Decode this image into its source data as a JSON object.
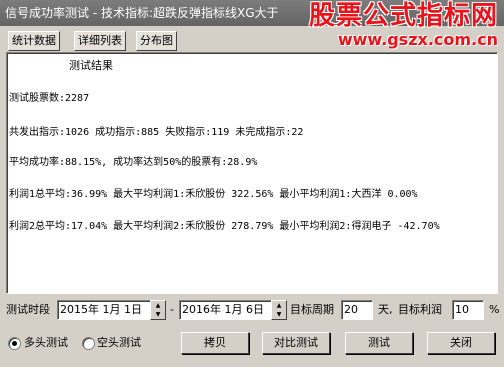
{
  "window": {
    "title": "信号成功率测试 - 技术指标:超跌反弹指标线XG大于",
    "watermark_main": "股票公式指标网",
    "watermark_url": "www.gszx.com.cn"
  },
  "tabs": [
    "统计数据",
    "详细列表",
    "分布图"
  ],
  "results": {
    "heading": "测试结果",
    "stock_count": "测试股票数:2287",
    "signals": "共发出指示:1026 成功指示:885 失败指示:119 未完成指示:22",
    "avg_success": "平均成功率:88.15%, 成功率达到50%的股票有:28.9%",
    "profit1": "利润1总平均:36.99% 最大平均利润1:禾欣股份 322.56% 最小平均利润1:大西洋 0.00%",
    "profit2": "利润2总平均:17.04% 最大平均利润2:禾欣股份 278.79% 最小平均利润2:得润电子 -42.70%"
  },
  "controls": {
    "period_label": "测试时段",
    "start_date": "2015年 1月 1日",
    "dash": "-",
    "end_date": "2016年 1月 6日",
    "cycle_label": "目标周期",
    "cycle_value": "20",
    "day_label": "天,",
    "profit_label": "目标利润",
    "profit_value": "10",
    "percent": "%",
    "radio_long": "多头测试",
    "radio_short": "空头测试",
    "btn_copy": "拷贝",
    "btn_compare": "对比测试",
    "btn_test": "测试",
    "btn_close": "关闭"
  }
}
